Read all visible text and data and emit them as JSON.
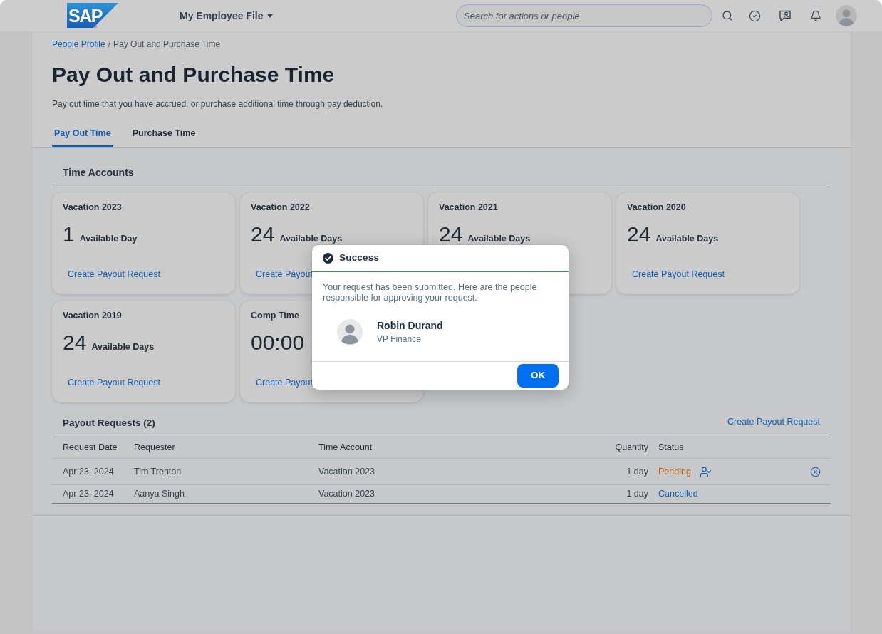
{
  "header": {
    "logo": {
      "text": "SAP",
      "mark": "®"
    },
    "app_menu": "My Employee File",
    "search": {
      "placeholder": "Search for actions or people"
    }
  },
  "breadcrumb": {
    "separator": "/",
    "items": [
      {
        "label": "People Profile",
        "kind": "link"
      },
      {
        "label": "Pay Out and Purchase Time",
        "kind": "current"
      }
    ]
  },
  "page": {
    "title": "Pay Out and Purchase Time",
    "description": "Pay out time that you have accrued, or purchase additional time through pay deduction."
  },
  "tabs": [
    {
      "label": "Pay Out Time",
      "selected": true
    },
    {
      "label": "Purchase Time",
      "selected": false
    }
  ],
  "time_accounts": {
    "title": "Time Accounts",
    "cards": [
      {
        "title": "Vacation 2023",
        "amount": "1",
        "unit": "Available Day",
        "action": "Create Payout Request"
      },
      {
        "title": "Vacation 2022",
        "amount": "24",
        "unit": "Available Days",
        "action": "Create Payout"
      },
      {
        "title": "Vacation 2021",
        "amount": "24",
        "unit": "Available Days"
      },
      {
        "title": "Vacation 2020",
        "amount": "24",
        "unit": "Available Days",
        "action": "Create Payout Request"
      },
      {
        "title": "Vacation 2019",
        "amount": "24",
        "unit": "Available Days",
        "action": "Create Payout Request"
      },
      {
        "title": "Comp Time",
        "amount": "00:00",
        "action": "Create Payout"
      }
    ]
  },
  "payout_requests": {
    "title": "Payout Requests (2)",
    "action": "Create Payout Request",
    "columns": [
      "Request Date",
      "Requester",
      "Time Account",
      "Quantity",
      "Status"
    ],
    "rows": [
      {
        "date": "Apr 23, 2024",
        "requester": "Tim Trenton",
        "account": "Vacation 2023",
        "quantity": "1 day",
        "status": {
          "label": "Pending",
          "kind": "pending"
        },
        "has_approvers": true,
        "cancellable": true
      },
      {
        "date": "Apr 23, 2024",
        "requester": "Aanya Singh",
        "account": "Vacation 2023",
        "quantity": "1 day",
        "status": {
          "label": "Cancelled",
          "kind": "cancelled"
        },
        "has_approvers": false,
        "cancellable": false
      }
    ]
  },
  "dialog": {
    "title": "Success",
    "message": "Your request has been submitted. Here are the people responsible for approving your request.",
    "approvers": [
      {
        "name": "Robin Durand",
        "role": "VP Finance"
      }
    ],
    "button": "OK"
  }
}
